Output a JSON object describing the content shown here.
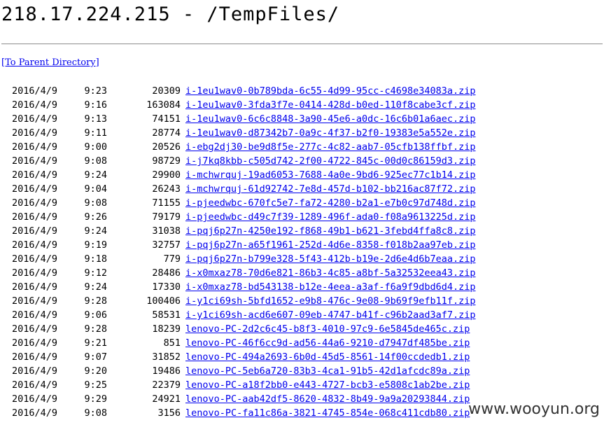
{
  "header": {
    "title": "218.17.224.215 - /TempFiles/"
  },
  "parent_link": {
    "label": "[To Parent Directory]"
  },
  "files": [
    {
      "date": "2016/4/9",
      "time": "9:23",
      "size": "20309",
      "name": "i-1eu1wav0-0b789bda-6c55-4d99-95cc-c4698e34083a.zip"
    },
    {
      "date": "2016/4/9",
      "time": "9:16",
      "size": "163084",
      "name": "i-1eu1wav0-3fda3f7e-0414-428d-b0ed-110f8cabe3cf.zip"
    },
    {
      "date": "2016/4/9",
      "time": "9:13",
      "size": "74151",
      "name": "i-1eu1wav0-6c6c8848-3a90-45e6-a0dc-16c6b01a6aec.zip"
    },
    {
      "date": "2016/4/9",
      "time": "9:11",
      "size": "28774",
      "name": "i-1eu1wav0-d87342b7-0a9c-4f37-b2f0-19383e5a552e.zip"
    },
    {
      "date": "2016/4/9",
      "time": "9:00",
      "size": "20526",
      "name": "i-ebg2dj30-be9d8f5e-277c-4c82-aab7-05cfb138ffbf.zip"
    },
    {
      "date": "2016/4/9",
      "time": "9:08",
      "size": "98729",
      "name": "i-j7kq8kbb-c505d742-2f00-4722-845c-00d0c86159d3.zip"
    },
    {
      "date": "2016/4/9",
      "time": "9:24",
      "size": "29900",
      "name": "i-mchwrquj-19ad6053-7688-4a0e-9bd6-925ec77c1b14.zip"
    },
    {
      "date": "2016/4/9",
      "time": "9:04",
      "size": "26243",
      "name": "i-mchwrquj-61d92742-7e8d-457d-b102-bb216ac87f72.zip"
    },
    {
      "date": "2016/4/9",
      "time": "9:08",
      "size": "71155",
      "name": "i-pjeedwbc-670fc5e7-fa72-4280-b2a1-e7b0c97d748d.zip"
    },
    {
      "date": "2016/4/9",
      "time": "9:26",
      "size": "79179",
      "name": "i-pjeedwbc-d49c7f39-1289-496f-ada0-f08a9613225d.zip"
    },
    {
      "date": "2016/4/9",
      "time": "9:24",
      "size": "31038",
      "name": "i-pqj6p27n-4250e192-f868-49b1-b621-3febd4ffa8c8.zip"
    },
    {
      "date": "2016/4/9",
      "time": "9:19",
      "size": "32757",
      "name": "i-pqj6p27n-a65f1961-252d-4d6e-8358-f018b2aa97eb.zip"
    },
    {
      "date": "2016/4/9",
      "time": "9:18",
      "size": "779",
      "name": "i-pqj6p27n-b799e328-5f43-412b-b19e-2d6e4d6b7eaa.zip"
    },
    {
      "date": "2016/4/9",
      "time": "9:12",
      "size": "28486",
      "name": "i-x0mxaz78-70d6e821-86b3-4c85-a8bf-5a32532eea43.zip"
    },
    {
      "date": "2016/4/9",
      "time": "9:24",
      "size": "17330",
      "name": "i-x0mxaz78-bd543138-b12e-4eea-a3af-f6a9f9dbd6d4.zip"
    },
    {
      "date": "2016/4/9",
      "time": "9:28",
      "size": "100406",
      "name": "i-y1ci69sh-5bfd1652-e9b8-476c-9e08-9b69f9efb11f.zip"
    },
    {
      "date": "2016/4/9",
      "time": "9:06",
      "size": "58531",
      "name": "i-y1ci69sh-acd6e607-09eb-4747-b41f-c96b2aad3af7.zip"
    },
    {
      "date": "2016/4/9",
      "time": "9:28",
      "size": "18239",
      "name": "lenovo-PC-2d2c6c45-b8f3-4010-97c9-6e5845de465c.zip"
    },
    {
      "date": "2016/4/9",
      "time": "9:21",
      "size": "851",
      "name": "lenovo-PC-46f6cc9d-ad56-44a6-9210-d7947df485be.zip"
    },
    {
      "date": "2016/4/9",
      "time": "9:07",
      "size": "31852",
      "name": "lenovo-PC-494a2693-6b0d-45d5-8561-14f00ccdedb1.zip"
    },
    {
      "date": "2016/4/9",
      "time": "9:20",
      "size": "19486",
      "name": "lenovo-PC-5eb6a720-83b3-4ca1-91b5-42d1afcdc89a.zip"
    },
    {
      "date": "2016/4/9",
      "time": "9:25",
      "size": "22379",
      "name": "lenovo-PC-a18f2bb0-e443-4727-bcb3-e5808c1ab2be.zip"
    },
    {
      "date": "2016/4/9",
      "time": "9:29",
      "size": "24921",
      "name": "lenovo-PC-aab42df5-8620-4832-8b49-9a9a20293844.zip"
    },
    {
      "date": "2016/4/9",
      "time": "9:08",
      "size": "3156",
      "name": "lenovo-PC-fa11c86a-3821-4745-854e-068c411cdb80.zip"
    }
  ],
  "watermark": {
    "text": "www.wooyun.org"
  }
}
